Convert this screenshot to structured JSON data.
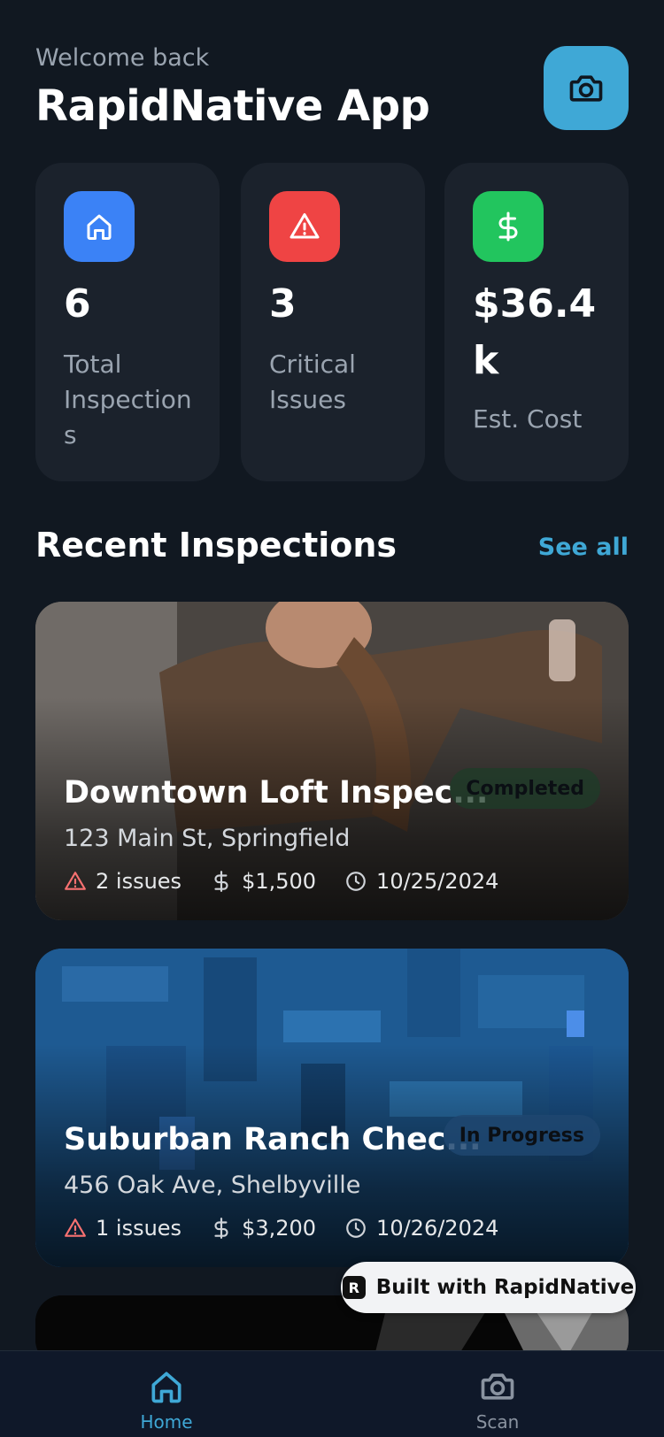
{
  "header": {
    "welcome": "Welcome back",
    "title": "RapidNative App"
  },
  "stats": [
    {
      "icon": "home-icon",
      "color": "#3b82f6",
      "value": "6",
      "label_lines": [
        "Total",
        "Inspection",
        "s"
      ]
    },
    {
      "icon": "warning-icon",
      "color": "#ef4444",
      "value": "3",
      "label_lines": [
        "Critical",
        "Issues"
      ]
    },
    {
      "icon": "dollar-icon",
      "color": "#22c55e",
      "value_lines": [
        "$36.4",
        "k"
      ],
      "label": "Est. Cost"
    }
  ],
  "recent": {
    "title": "Recent Inspections",
    "see_all": "See all"
  },
  "inspections": [
    {
      "title": "Downtown Loft Inspec...",
      "status": "Completed",
      "status_color": "#1f3a2a",
      "address": "123 Main St, Springfield",
      "issues": "2 issues",
      "cost": "$1,500",
      "date": "10/25/2024"
    },
    {
      "title": "Suburban Ranch Chec...",
      "status": "In Progress",
      "status_color": "#1d4670",
      "address": "456 Oak Ave, Shelbyville",
      "issues": "1 issues",
      "cost": "$3,200",
      "date": "10/26/2024"
    }
  ],
  "built_with": "Built with RapidNative",
  "tabs": [
    {
      "label": "Home",
      "icon": "home-icon",
      "active": true
    },
    {
      "label": "Scan",
      "icon": "camera-icon",
      "active": false
    }
  ],
  "colors": {
    "accent": "#3fa8d6",
    "background": "#111821",
    "card": "#1b222c"
  }
}
